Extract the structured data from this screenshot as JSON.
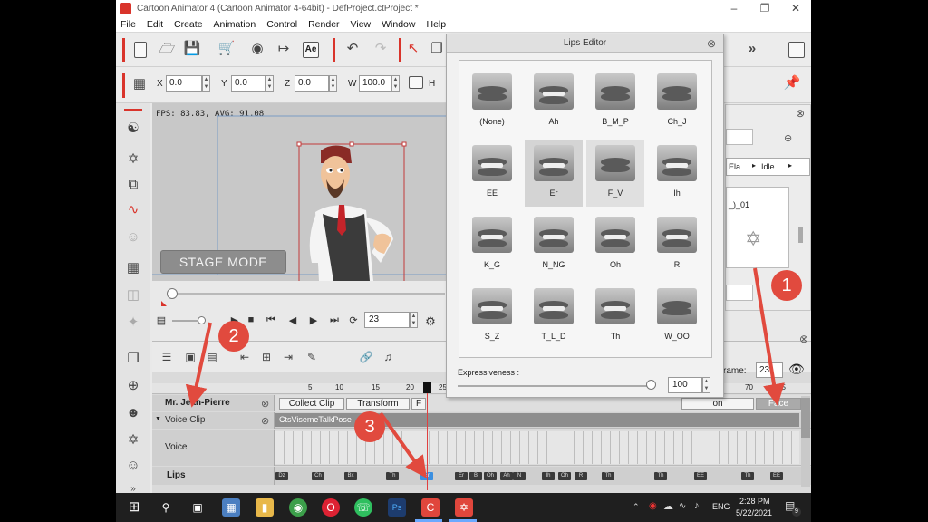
{
  "window": {
    "title": "Cartoon Animator 4  (Cartoon Animator 4-64bit) - DefProject.ctProject *",
    "min": "–",
    "max": "❐",
    "close": "✕"
  },
  "menu": [
    "File",
    "Edit",
    "Create",
    "Animation",
    "Control",
    "Render",
    "View",
    "Window",
    "Help"
  ],
  "transform": {
    "x_label": "X",
    "x_value": "0.0",
    "y_label": "Y",
    "y_value": "0.0",
    "z_label": "Z",
    "z_value": "0.0",
    "w_label": "W",
    "w_value": "100.0",
    "h_label": "H"
  },
  "viewport": {
    "fps": "FPS: 83.83, AVG: 91.08",
    "stage_mode": "STAGE MODE"
  },
  "playback": {
    "frame": "23"
  },
  "lips_editor": {
    "title": "Lips Editor",
    "visemes": [
      "(None)",
      "Ah",
      "B_M_P",
      "Ch_J",
      "EE",
      "Er",
      "F_V",
      "Ih",
      "K_G",
      "N_NG",
      "Oh",
      "R",
      "S_Z",
      "T_L_D",
      "Th",
      "W_OO"
    ],
    "selected": "Er",
    "hovered": "F_V",
    "expressiveness_label": "Expressiveness :",
    "expressiveness_value": "100",
    "expressiveness_level": 1.0
  },
  "right_panel": {
    "dropdown1": "Ela...",
    "dropdown2": "Idle ...",
    "item": "_)_01",
    "frame_label": "rame:",
    "frame_value": "23",
    "tag_on": "on",
    "tag_face": "Face"
  },
  "timeline": {
    "ruler": [
      "5",
      "10",
      "15",
      "20",
      "25",
      "70",
      "75"
    ],
    "actor": "Mr. Jean-Pierre",
    "tracks": [
      "Collect Clip",
      "Transform",
      "F"
    ],
    "voice_clip": "Voice Clip",
    "clip_name": "CtsVisemeTalkPose",
    "voice_label": "Voice",
    "lips_label": "Lips"
  },
  "taskbar": {
    "lang": "ENG",
    "time": "2:28 PM",
    "date": "5/22/2021",
    "notif": "9"
  },
  "annotations": [
    "1",
    "2",
    "3"
  ],
  "colors": {
    "accent": "#d9342b",
    "annotation": "#e14a3e",
    "playhead": "#e04040"
  }
}
